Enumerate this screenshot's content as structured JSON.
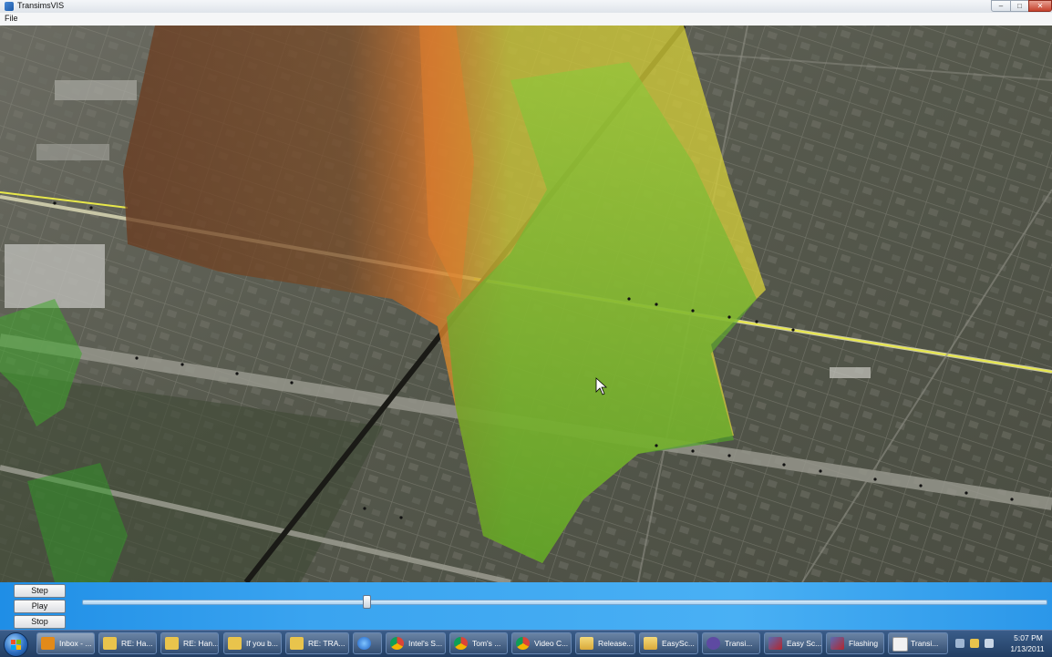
{
  "window": {
    "title": "TransimsVIS",
    "minimize": "–",
    "maximize": "□",
    "close": "✕"
  },
  "menu": {
    "file": "File"
  },
  "controls": {
    "step_label": "Step",
    "play_label": "Play",
    "stop_label": "Stop",
    "timeline_position": 0.29
  },
  "taskbar": {
    "items": [
      {
        "label": "Inbox - ...",
        "icon": "outlook-icon"
      },
      {
        "label": "RE: Ha...",
        "icon": "mail-icon"
      },
      {
        "label": "RE: Han...",
        "icon": "mail-icon"
      },
      {
        "label": "If you b...",
        "icon": "mail-icon"
      },
      {
        "label": "RE: TRA...",
        "icon": "mail-icon"
      },
      {
        "label": "",
        "icon": "internet-explorer-icon"
      },
      {
        "label": "Intel's S...",
        "icon": "chrome-icon"
      },
      {
        "label": "Tom's ...",
        "icon": "chrome-icon"
      },
      {
        "label": "Video C...",
        "icon": "chrome-icon"
      },
      {
        "label": "Release...",
        "icon": "folder-icon"
      },
      {
        "label": "EasySc...",
        "icon": "folder-icon"
      },
      {
        "label": "Transi...",
        "icon": "visual-studio-icon"
      },
      {
        "label": "Easy Sc...",
        "icon": "app-icon"
      },
      {
        "label": "Flashing",
        "icon": "app-icon"
      },
      {
        "label": "Transi...",
        "icon": "document-icon"
      }
    ],
    "clock_time": "5:07 PM",
    "clock_date": "1/13/2011"
  },
  "colors": {
    "taskbar": "#2a4a74",
    "controls_blue": "#3aa4f0",
    "heat_green": "#4fa82a",
    "heat_yellow": "#d8d23a",
    "heat_orange": "#d9782a",
    "road_yellow": "#e8e84a"
  }
}
